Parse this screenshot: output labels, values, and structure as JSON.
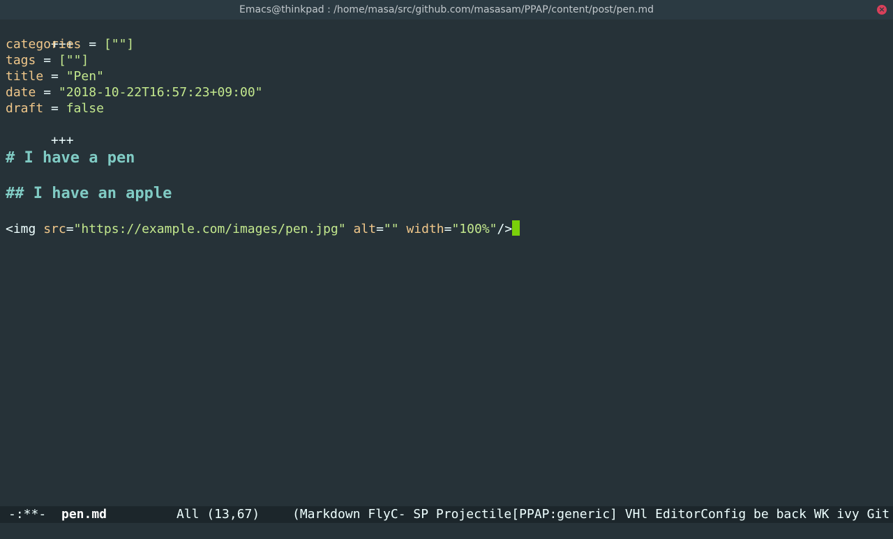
{
  "window": {
    "title": "Emacs@thinkpad : /home/masa/src/github.com/masasam/PPAP/content/post/pen.md",
    "close_icon": "close-icon",
    "close_glyph": "×"
  },
  "editor": {
    "frontmatter_open": "+++",
    "categories_key": "categories",
    "categories_value": "[\"\"]",
    "tags_key": "tags",
    "tags_value": "[\"\"]",
    "title_key": "title",
    "title_value": "\"Pen\"",
    "date_key": "date",
    "date_value": "\"2018-10-22T16:57:23+09:00\"",
    "draft_key": "draft",
    "draft_value": "false",
    "frontmatter_close": "+++",
    "equals": "=",
    "heading1": "# I have a pen",
    "heading2": "## I have an apple",
    "img_open": "<img",
    "img_src_attr": "src",
    "img_src_value": "\"https://example.com/images/pen.jpg\"",
    "img_alt_attr": "alt",
    "img_alt_value": "\"\"",
    "img_width_attr": "width",
    "img_width_value": "\"100%\"",
    "img_close": "/>"
  },
  "modeline": {
    "status": "-:**-",
    "buffer_name": "pen.md",
    "position": "All (13,67)",
    "modes": "(Markdown FlyC- SP Projectile[PPAP:generic] VHl EditorConfig be back WK ivy Git"
  },
  "colors": {
    "background": "#263238",
    "heading": "#80cbc4",
    "key": "#f0c78a",
    "string": "#c3e88d",
    "cursor": "#7ad00a"
  }
}
